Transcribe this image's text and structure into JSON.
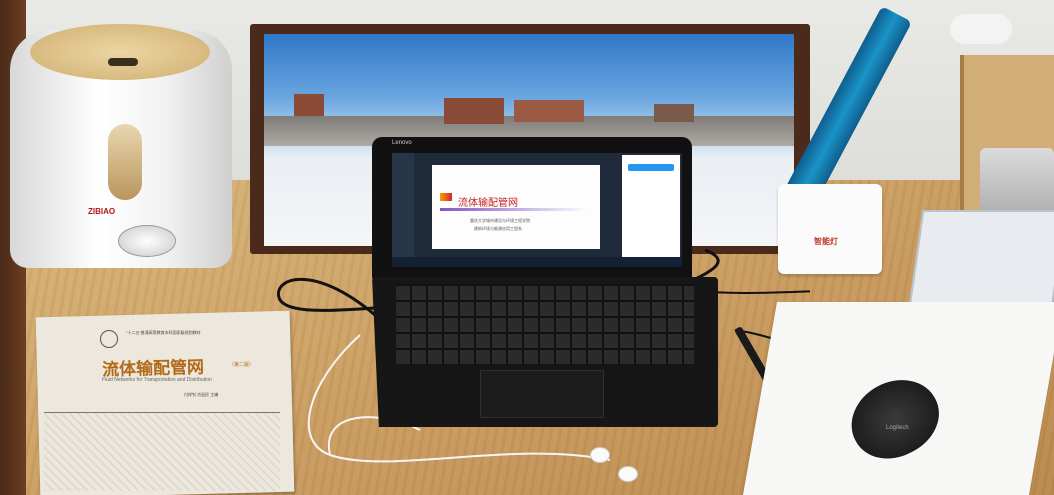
{
  "book": {
    "series_header": "“十二五”普通高等教育本科国家级规划教材",
    "title": "流体输配管网",
    "edition_note": "（第二版）",
    "english_title": "Fluid Networks for Transportation and Distribution",
    "authors": "付祥钊 肖益民 主编"
  },
  "laptop": {
    "brand": "Lenovo",
    "slide_title": "流体输配管网",
    "slide_line_1": "重庆大学城市建设与环境工程学院",
    "slide_line_2": "建筑环境与能源应用工程系"
  },
  "humidifier": {
    "brand": "ZIBIAO"
  },
  "lamp": {
    "label": "智能灯"
  },
  "mouse": {
    "brand": "Logitech"
  }
}
